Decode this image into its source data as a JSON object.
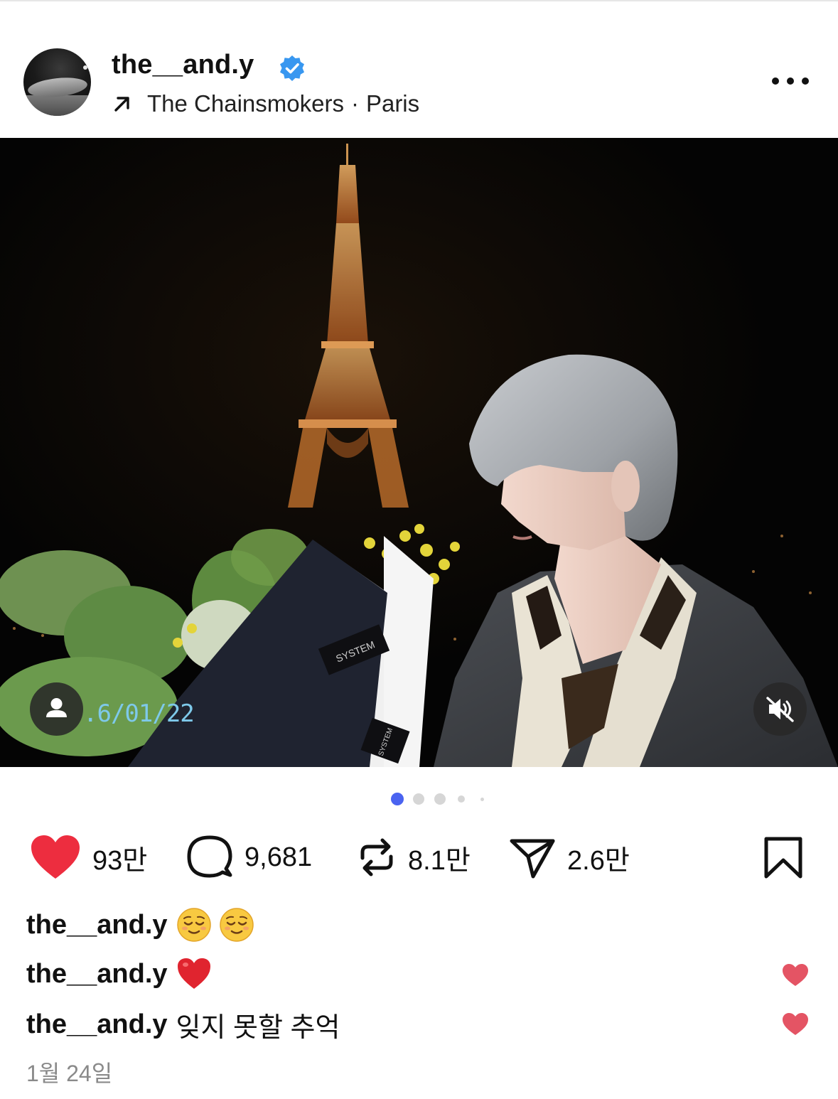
{
  "header": {
    "username": "the__and.y",
    "verified_icon": "verified-badge-icon",
    "audio_label": "The Chainsmokers",
    "location_separator": "·",
    "location": "Paris",
    "more_icon": "more-horizontal-icon"
  },
  "media": {
    "date_stamp": ".6/01/22",
    "tag_icon": "user-tag-icon",
    "mute_icon": "speaker-muted-icon",
    "bouquet_label": "SYSTEM",
    "bouquet_label_small": "SYSTEM"
  },
  "pager": {
    "count": 5,
    "active_index": 0,
    "active_color": "#4a63f0"
  },
  "actions": {
    "likes": "93만",
    "comments": "9,681",
    "reposts": "8.1만",
    "shares": "2.6만",
    "like_color": "#ed2d3f"
  },
  "comments": [
    {
      "username": "the__and.y",
      "text": "",
      "emojis": [
        "relieved-face",
        "relieved-face"
      ],
      "liked": false
    },
    {
      "username": "the__and.y",
      "text": "",
      "emojis": [
        "red-heart"
      ],
      "liked": true
    },
    {
      "username": "the__and.y",
      "text": "잊지 못할 추억",
      "emojis": [],
      "liked": true
    }
  ],
  "post_date": "1월 24일"
}
